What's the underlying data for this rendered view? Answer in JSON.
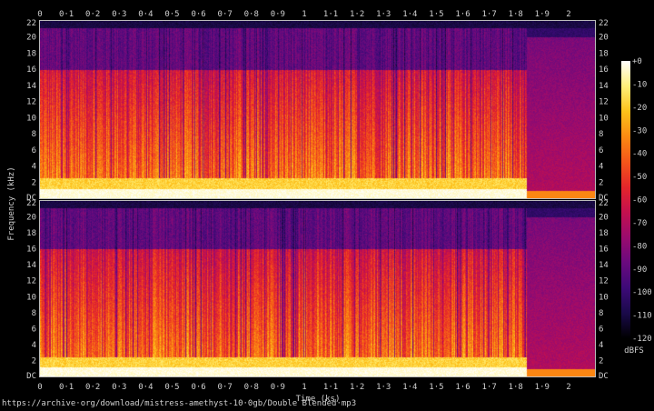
{
  "chart_data": {
    "type": "heatmap",
    "title": "",
    "xlabel": "Time (ks)",
    "ylabel": "Frequency (kHz)",
    "x_ticks": [
      "0",
      "0·1",
      "0·2",
      "0·3",
      "0·4",
      "0·5",
      "0·6",
      "0·7",
      "0·8",
      "0·9",
      "1",
      "1·1",
      "1·2",
      "1·3",
      "1·4",
      "1·5",
      "1·6",
      "1·7",
      "1·8",
      "1·9",
      "2"
    ],
    "x_range": [
      0,
      2.1
    ],
    "y_ticks": [
      "DC",
      "2",
      "4",
      "6",
      "8",
      "10",
      "12",
      "14",
      "16",
      "18",
      "20",
      "22"
    ],
    "y_range_khz": [
      0,
      22
    ],
    "channels": 2,
    "colorbar": {
      "label": "dBFS",
      "ticks": [
        "+0",
        "-10",
        "-20",
        "-30",
        "-40",
        "-50",
        "-60",
        "-70",
        "-80",
        "-90",
        "-100",
        "-110",
        "-120"
      ],
      "range": [
        -120,
        0
      ],
      "colors": [
        "#000000",
        "#1a0a4a",
        "#3d0a78",
        "#6a0a7e",
        "#9a0b6e",
        "#c4104e",
        "#e5262a",
        "#f4561a",
        "#fb8a12",
        "#fdc21a",
        "#fff07a",
        "#ffffff"
      ]
    },
    "audio_end_ks": 1.84,
    "lowpass_khz_main": 16,
    "lowpass_khz_tail": 20
  },
  "source_url": "https://archive·org/download/mistress-amethyst-10·0gb/Double Blended·mp3"
}
